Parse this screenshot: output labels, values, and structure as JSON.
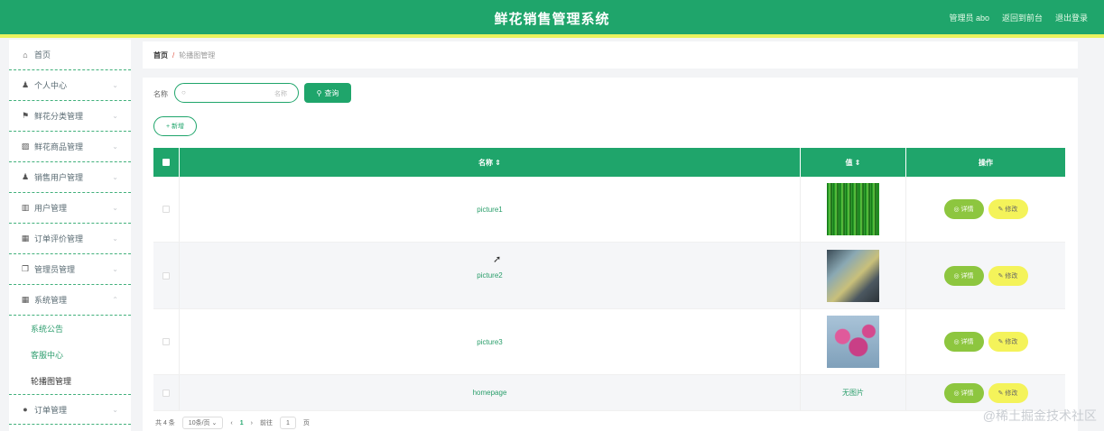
{
  "header": {
    "title": "鲜花销售管理系统",
    "user": "管理员 abo",
    "front_link": "返回到前台",
    "logout": "退出登录"
  },
  "sidebar": {
    "items": [
      {
        "label": "首页",
        "icon": "home-icon",
        "glyph": "⌂"
      },
      {
        "label": "个人中心",
        "icon": "user-icon",
        "glyph": "♟"
      },
      {
        "label": "鲜花分类管理",
        "icon": "flag-icon",
        "glyph": "⚑"
      },
      {
        "label": "鲜花商品管理",
        "icon": "image-icon",
        "glyph": "▨"
      },
      {
        "label": "销售用户管理",
        "icon": "person-icon",
        "glyph": "♟"
      },
      {
        "label": "用户管理",
        "icon": "chart-icon",
        "glyph": "▥"
      },
      {
        "label": "订单评价管理",
        "icon": "table-icon",
        "glyph": "▦"
      },
      {
        "label": "管理员管理",
        "icon": "copy-icon",
        "glyph": "❐"
      },
      {
        "label": "系统管理",
        "icon": "grid-icon",
        "glyph": "▦"
      }
    ],
    "sub_items": [
      "系统公告",
      "客服中心",
      "轮播图管理"
    ],
    "last_item": {
      "label": "订单管理",
      "icon": "location-icon",
      "glyph": "●"
    }
  },
  "breadcrumb": {
    "home": "首页",
    "sep": "/",
    "current": "轮播图管理"
  },
  "search": {
    "label": "名称",
    "placeholder": "名称",
    "button": "查询"
  },
  "add_button": "+ 新增",
  "table": {
    "headers": {
      "name": "名称 ⇕",
      "image": "值 ⇕",
      "ops": "操作"
    },
    "rows": [
      {
        "name": "picture1",
        "image": "grass"
      },
      {
        "name": "picture2",
        "image": "glass"
      },
      {
        "name": "picture3",
        "image": "flower"
      },
      {
        "name": "homepage",
        "image": "none",
        "image_text": "无图片"
      }
    ],
    "detail_label": "◎ 详情",
    "edit_label": "✎ 修改"
  },
  "pager": {
    "total": "共 4 条",
    "per_page": "10条/页",
    "page": "1",
    "goto": "前往",
    "goto_value": "1",
    "page_unit": "页"
  },
  "watermark": "@稀土掘金技术社区",
  "colors": {
    "primary": "#1fa56b",
    "accent_strip": "#e9f25e",
    "detail": "#8dc63f",
    "edit": "#f4f35a"
  }
}
